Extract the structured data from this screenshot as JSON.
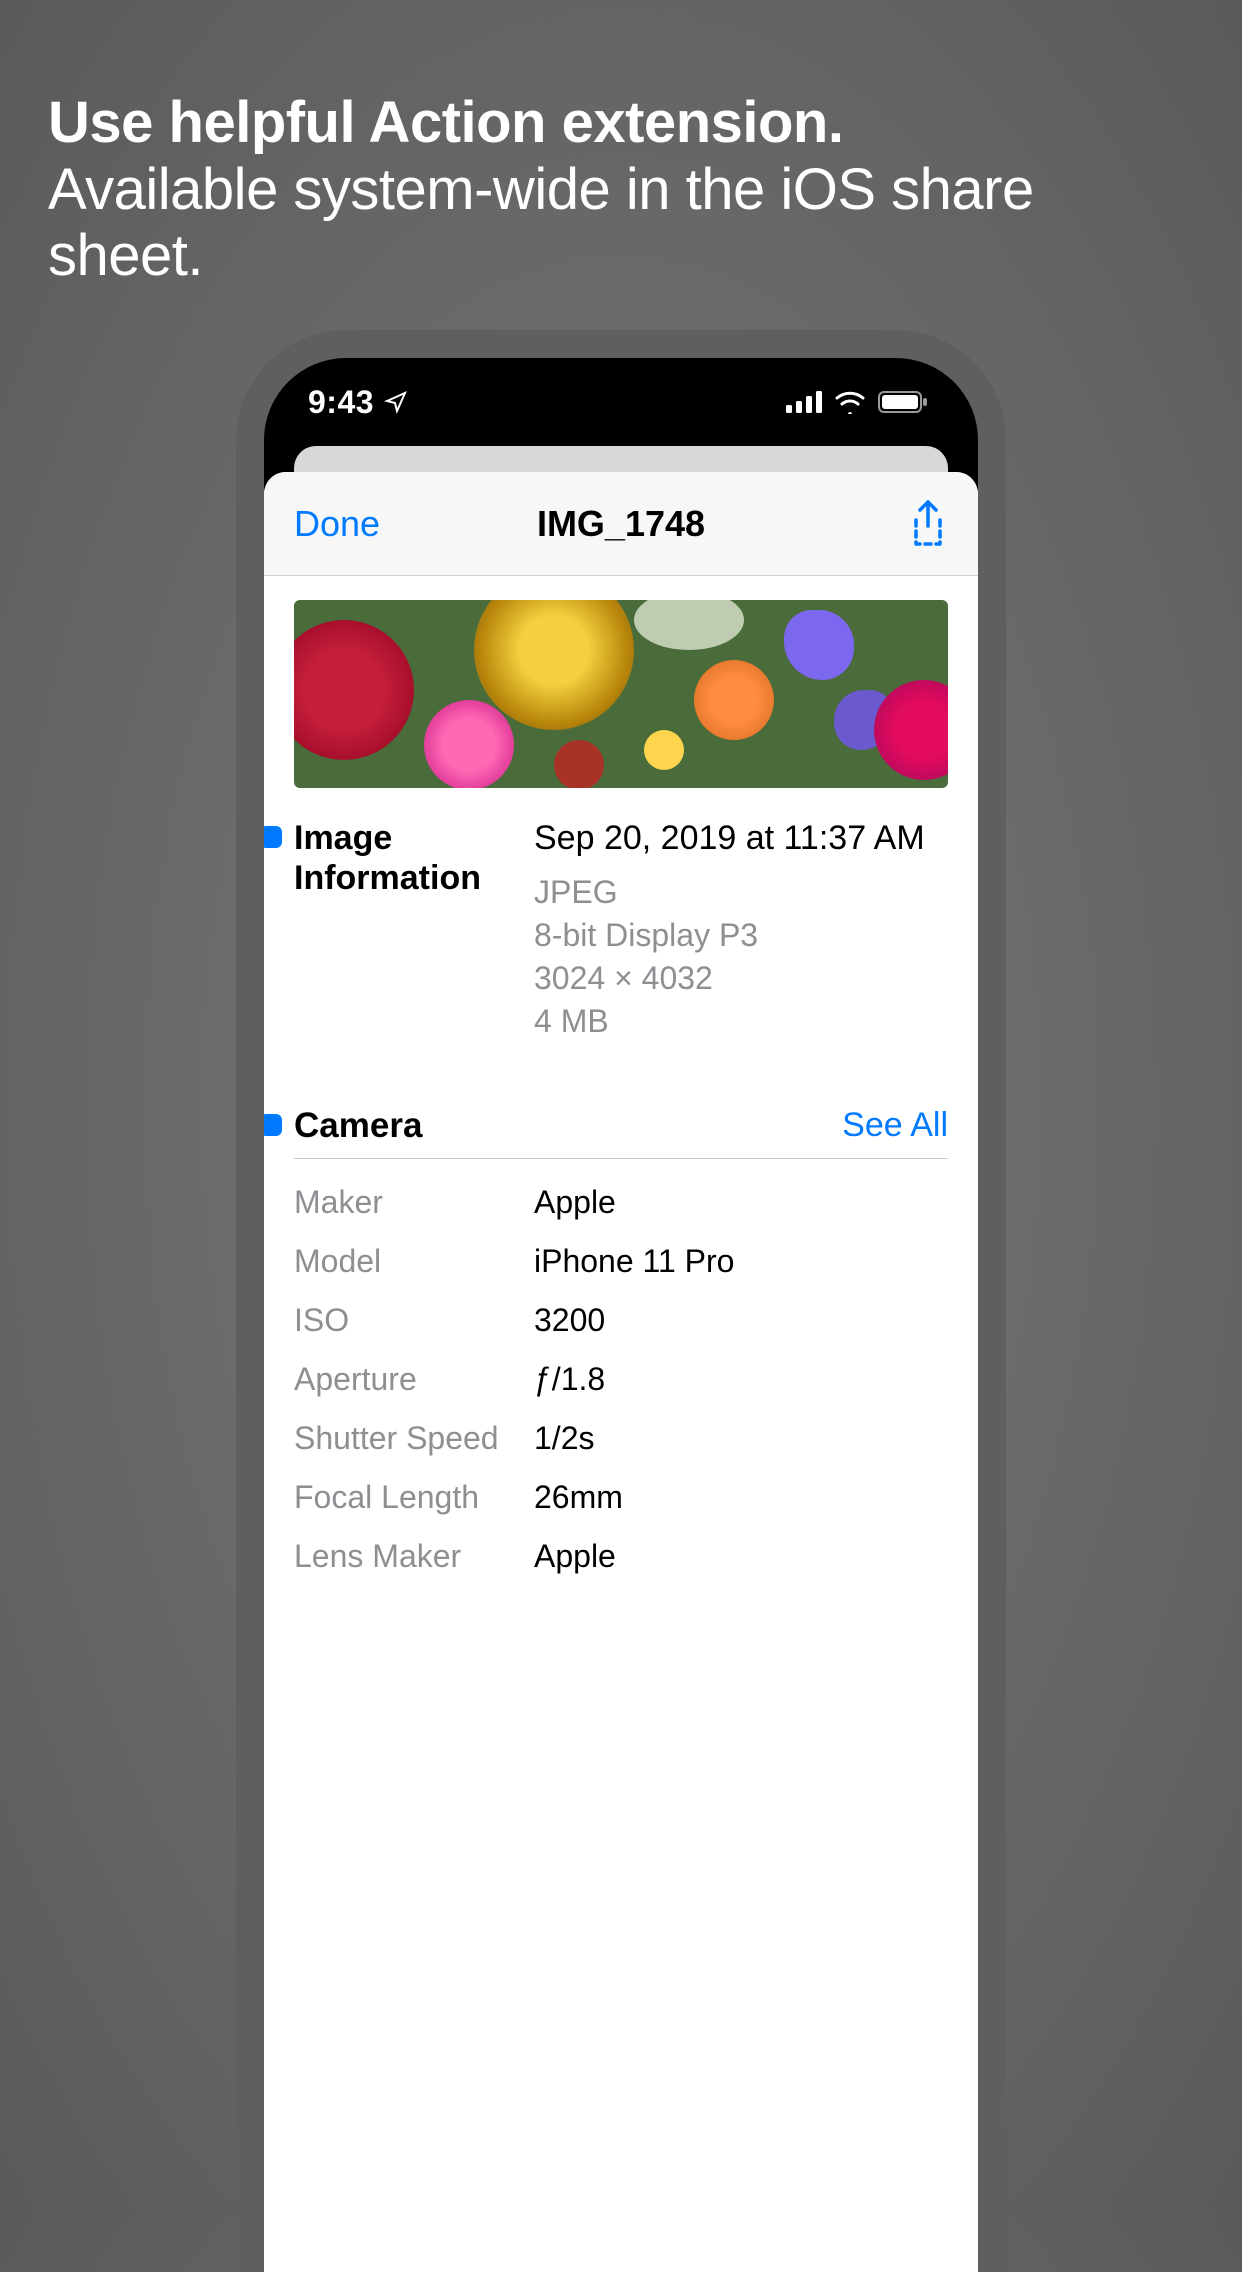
{
  "promo": {
    "line1": "Use helpful Action extension.",
    "line2": "Available system-wide in the iOS share sheet."
  },
  "status": {
    "time": "9:43"
  },
  "nav": {
    "done": "Done",
    "title": "IMG_1748"
  },
  "image_info": {
    "section_label": "Image Information",
    "datetime": "Sep 20, 2019 at 11:37 AM",
    "format": "JPEG",
    "color": "8-bit Display P3",
    "dimensions": "3024 × 4032",
    "size": "4 MB"
  },
  "camera": {
    "title": "Camera",
    "see_all": "See All",
    "rows": [
      {
        "label": "Maker",
        "value": "Apple"
      },
      {
        "label": "Model",
        "value": "iPhone 11 Pro"
      },
      {
        "label": "ISO",
        "value": "3200"
      },
      {
        "label": "Aperture",
        "value": "ƒ/1.8"
      },
      {
        "label": "Shutter Speed",
        "value": "1/2s"
      },
      {
        "label": "Focal Length",
        "value": "26mm"
      },
      {
        "label": "Lens Maker",
        "value": "Apple"
      }
    ]
  }
}
